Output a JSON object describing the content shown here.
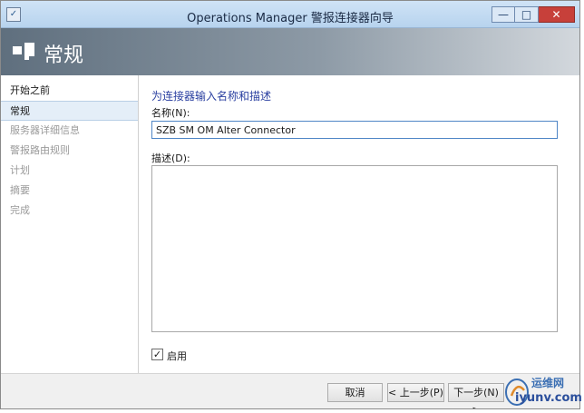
{
  "window": {
    "title": "Operations Manager 警报连接器向导",
    "controls": {
      "minimize": "—",
      "maximize": "□",
      "close": "✕"
    }
  },
  "header": {
    "title": "常规"
  },
  "nav": {
    "items": [
      {
        "label": "开始之前",
        "state": "done"
      },
      {
        "label": "常规",
        "state": "current"
      },
      {
        "label": "服务器详细信息",
        "state": "pending"
      },
      {
        "label": "警报路由规则",
        "state": "pending"
      },
      {
        "label": "计划",
        "state": "pending"
      },
      {
        "label": "摘要",
        "state": "pending"
      },
      {
        "label": "完成",
        "state": "pending"
      }
    ]
  },
  "content": {
    "section_title": "为连接器输入名称和描述",
    "name_label": "名称(N):",
    "name_value": "SZB SM OM Alter Connector",
    "description_label": "描述(D):",
    "description_value": "",
    "enable_label": "启用",
    "enable_checked": true
  },
  "footer": {
    "cancel": "取消",
    "previous": "< 上一步(P)",
    "next": "下一步(N) >"
  },
  "watermark": {
    "line1": "运维网",
    "line2": "iyunv.com"
  },
  "colors": {
    "accent": "#2a3fa0",
    "titlebar": "#b7d3ee",
    "header_dark": "#5f6f7e",
    "close_button": "#c7403a"
  }
}
